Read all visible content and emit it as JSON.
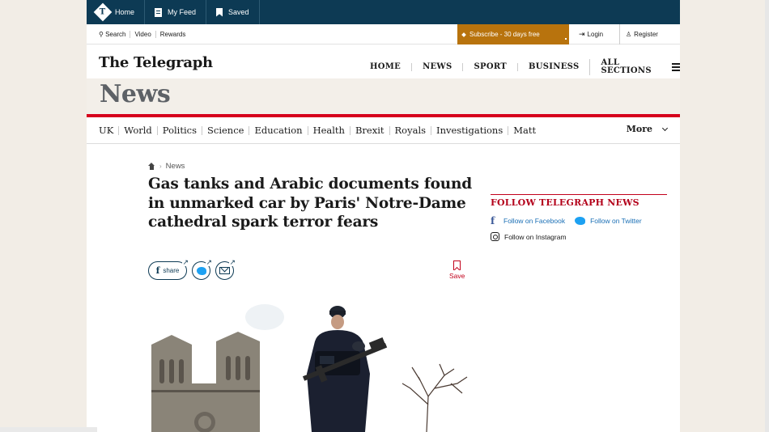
{
  "topbar": {
    "home_label": "Home",
    "myfeed_label": "My Feed",
    "saved_label": "Saved"
  },
  "utility": {
    "search_label": "Search",
    "video_label": "Video",
    "rewards_label": "Rewards",
    "subscribe_label": "Subscribe - 30 days free",
    "login_label": "Login",
    "register_label": "Register"
  },
  "masthead": {
    "brand": "The Telegraph",
    "nav": [
      "HOME",
      "NEWS",
      "SPORT",
      "BUSINESS",
      "ALL SECTIONS"
    ]
  },
  "section": {
    "title": "News"
  },
  "subnav": {
    "items": [
      "UK",
      "World",
      "Politics",
      "Science",
      "Education",
      "Health",
      "Brexit",
      "Royals",
      "Investigations",
      "Matt"
    ],
    "more_label": "More"
  },
  "article": {
    "breadcrumb": "News",
    "headline": "Gas tanks and Arabic documents found in unmarked car by Paris' Notre-Dame cathedral spark terror fears",
    "share_label": "share",
    "save_label": "Save"
  },
  "follow": {
    "title": "FOLLOW TELEGRAPH NEWS",
    "facebook": "Follow on Facebook",
    "twitter": "Follow on Twitter",
    "instagram": "Follow on Instagram"
  },
  "colors": {
    "navy": "#0d3a54",
    "accent_red": "#d6001c",
    "subscribe": "#b8730d",
    "link_blue": "#1a6fb5"
  }
}
